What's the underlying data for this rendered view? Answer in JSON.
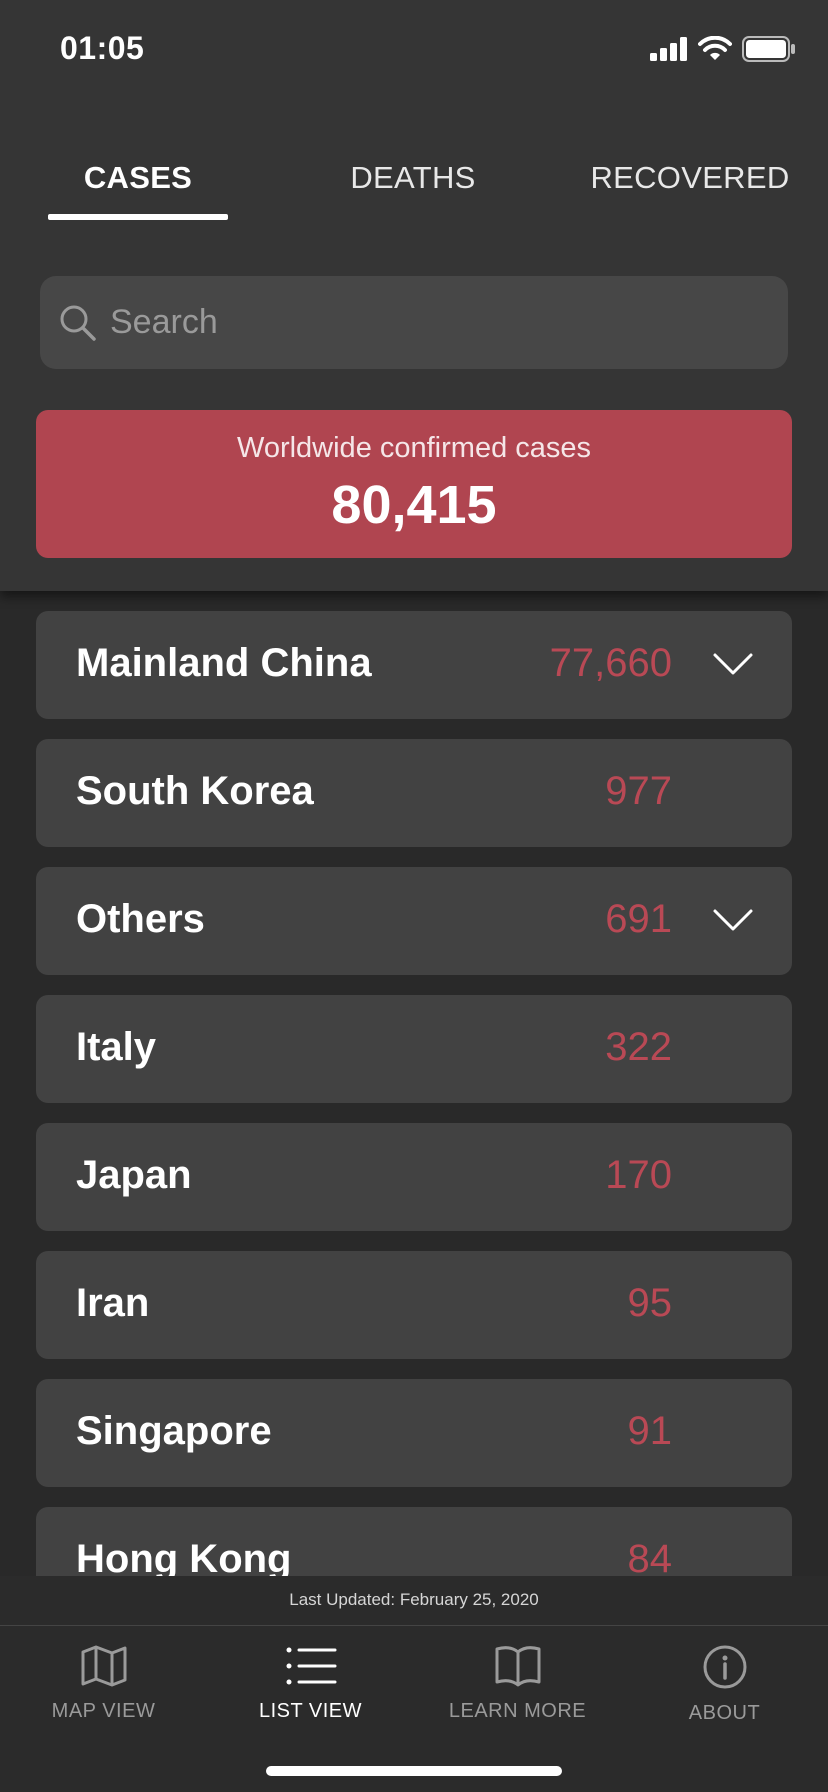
{
  "status": {
    "time": "01:05",
    "icons": [
      "cellular-signal-icon",
      "wifi-icon",
      "battery-icon"
    ]
  },
  "tabs": [
    {
      "label": "CASES",
      "active": true
    },
    {
      "label": "DEATHS",
      "active": false
    },
    {
      "label": "RECOVERED",
      "active": false
    }
  ],
  "search": {
    "placeholder": "Search",
    "value": ""
  },
  "summary": {
    "label": "Worldwide confirmed cases",
    "value": "80,415",
    "color": "#b04550"
  },
  "list": [
    {
      "name": "Mainland China",
      "count": "77,660",
      "expandable": true
    },
    {
      "name": "South Korea",
      "count": "977",
      "expandable": false
    },
    {
      "name": "Others",
      "count": "691",
      "expandable": true
    },
    {
      "name": "Italy",
      "count": "322",
      "expandable": false
    },
    {
      "name": "Japan",
      "count": "170",
      "expandable": false
    },
    {
      "name": "Iran",
      "count": "95",
      "expandable": false
    },
    {
      "name": "Singapore",
      "count": "91",
      "expandable": false
    },
    {
      "name": "Hong Kong",
      "count": "84",
      "expandable": false
    }
  ],
  "footer": {
    "last_updated": "Last Updated: February 25, 2020"
  },
  "nav": [
    {
      "label": "MAP VIEW",
      "icon": "map-icon",
      "active": false
    },
    {
      "label": "LIST VIEW",
      "icon": "list-icon",
      "active": true
    },
    {
      "label": "LEARN MORE",
      "icon": "book-icon",
      "active": false
    },
    {
      "label": "ABOUT",
      "icon": "info-icon",
      "active": false
    }
  ],
  "colors": {
    "accent": "#b04550",
    "count_text": "#b94955",
    "background": "#292929",
    "card": "#424242"
  }
}
